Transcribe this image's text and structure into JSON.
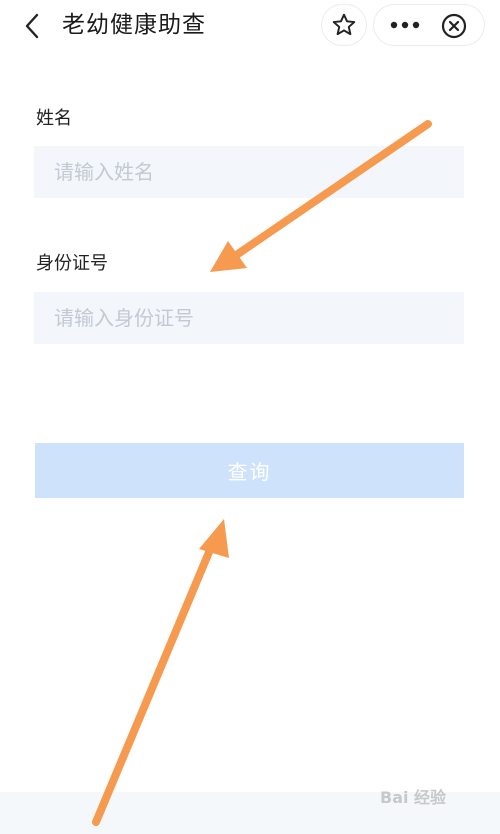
{
  "nav": {
    "title": "老幼健康助查",
    "icons": {
      "back": "chevron-left-icon",
      "star": "star-icon",
      "more": "more-icon",
      "close": "close-circle-icon"
    }
  },
  "form": {
    "name_label": "姓名",
    "name_placeholder": "请输入姓名",
    "name_value": "",
    "id_label": "身份证号",
    "id_placeholder": "请输入身份证号",
    "id_value": "",
    "submit_label": "查询"
  },
  "colors": {
    "input_bg": "#f3f7fc",
    "button_bg": "#cfe2fb",
    "annotation_arrow": "#f59a4e"
  },
  "watermark": "Bai 经验"
}
